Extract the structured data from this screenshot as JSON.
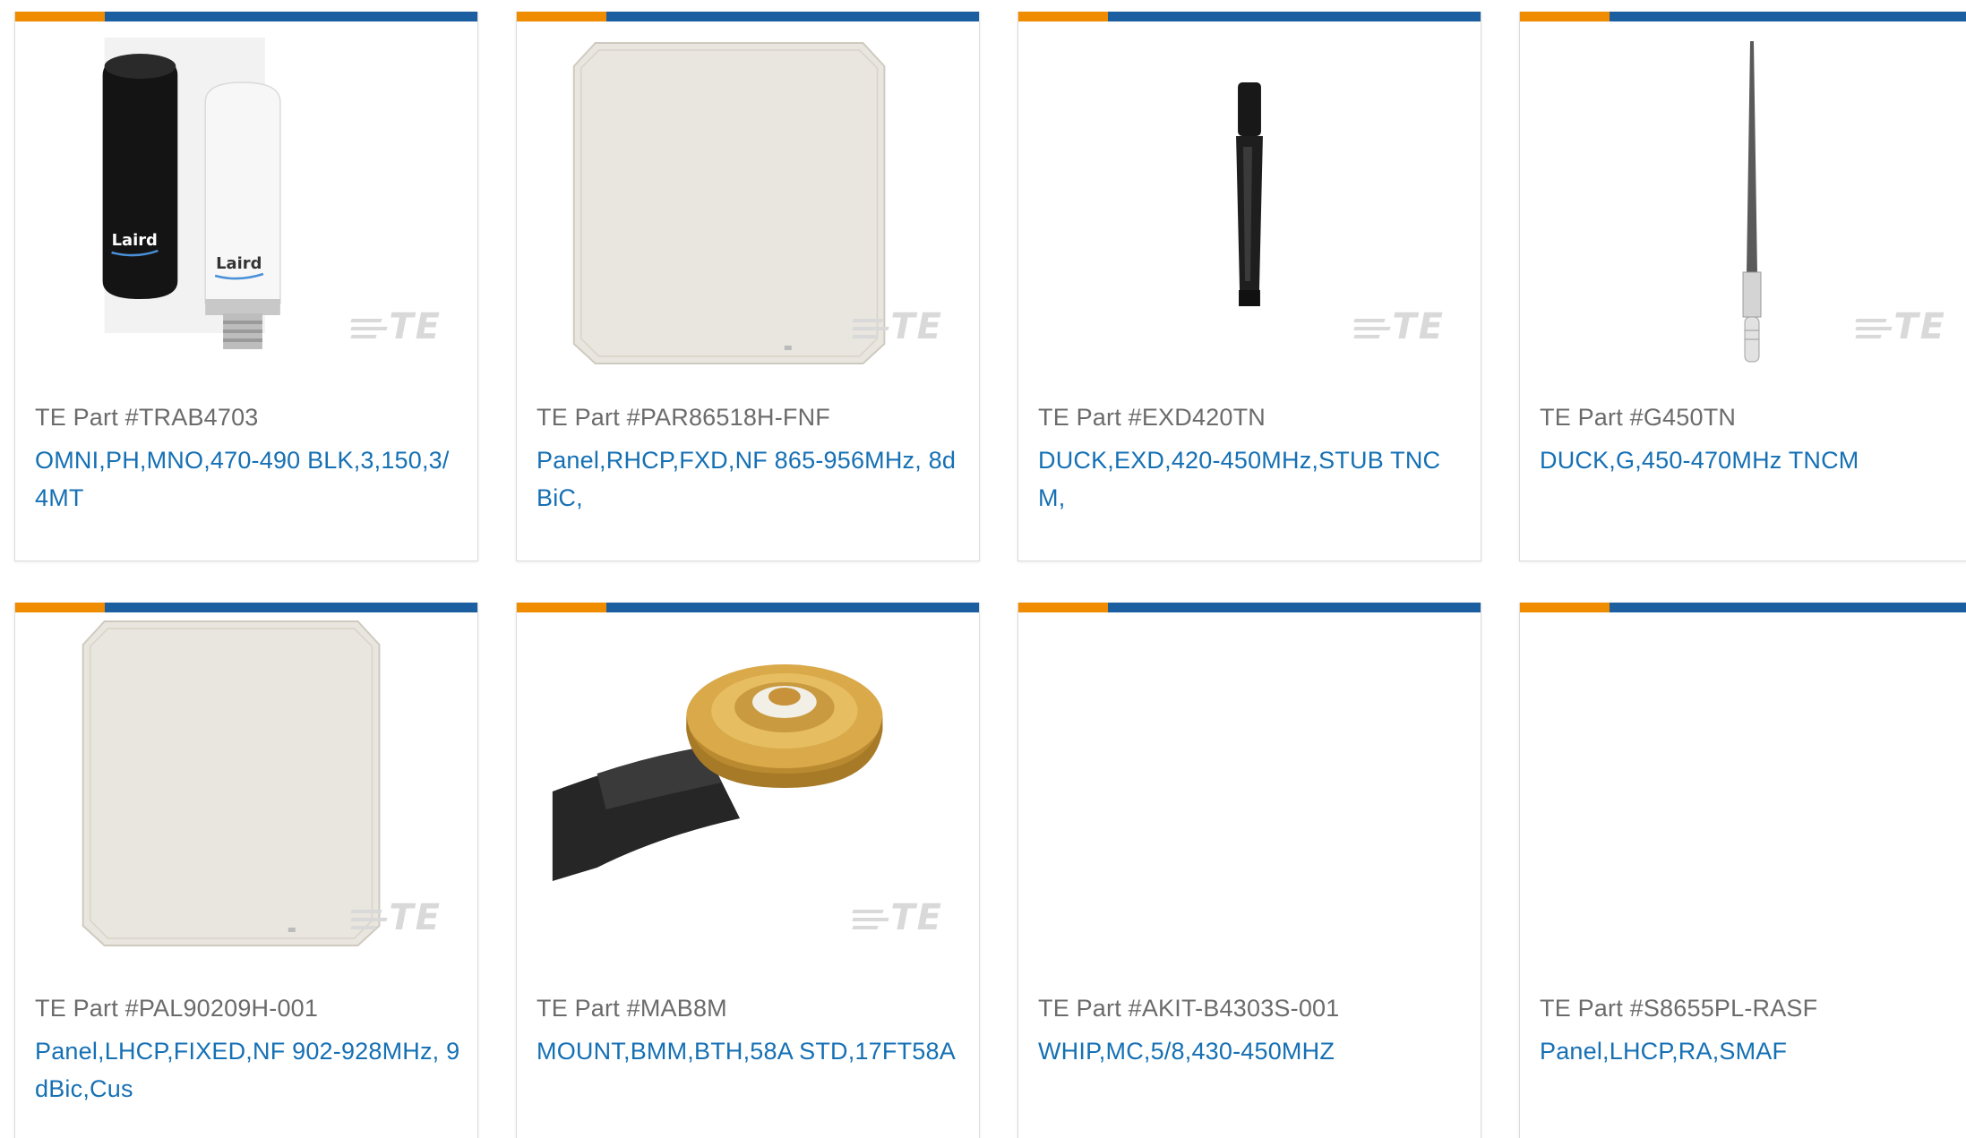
{
  "watermark": "TE",
  "colors": {
    "accent_orange": "#f08c00",
    "accent_blue": "#1c5fa0",
    "link": "#1570b4",
    "part_text": "#6b6b6b"
  },
  "products": [
    {
      "part": "TE Part #TRAB4703",
      "desc": "OMNI,PH,MNO,470-490 BLK,3,150,3/4MT",
      "image": "omni-antenna-image",
      "brand_label": "Laird"
    },
    {
      "part": "TE Part #PAR86518H-FNF",
      "desc": "Panel,RHCP,FXD,NF 865-956MHz, 8dBiC,",
      "image": "panel-antenna-image"
    },
    {
      "part": "TE Part #EXD420TN",
      "desc": "DUCK,EXD,420-450MHz,STUB TNCM,",
      "image": "stub-antenna-image"
    },
    {
      "part": "TE Part #G450TN",
      "desc": "DUCK,G,450-470MHz TNCM",
      "image": "whip-antenna-image"
    },
    {
      "part": "TE Part #PAL90209H-001",
      "desc": "Panel,LHCP,FIXED,NF 902-928MHz, 9dBic,Cus",
      "image": "panel-antenna-image"
    },
    {
      "part": "TE Part #MAB8M",
      "desc": "MOUNT,BMM,BTH,58A STD,17FT58A",
      "image": "mount-image"
    },
    {
      "part": "TE Part #AKIT-B4303S-001",
      "desc": "WHIP,MC,5/8,430-450MHZ",
      "image": ""
    },
    {
      "part": "TE Part #S8655PL-RASF",
      "desc": "Panel,LHCP,RA,SMAF",
      "image": ""
    }
  ]
}
